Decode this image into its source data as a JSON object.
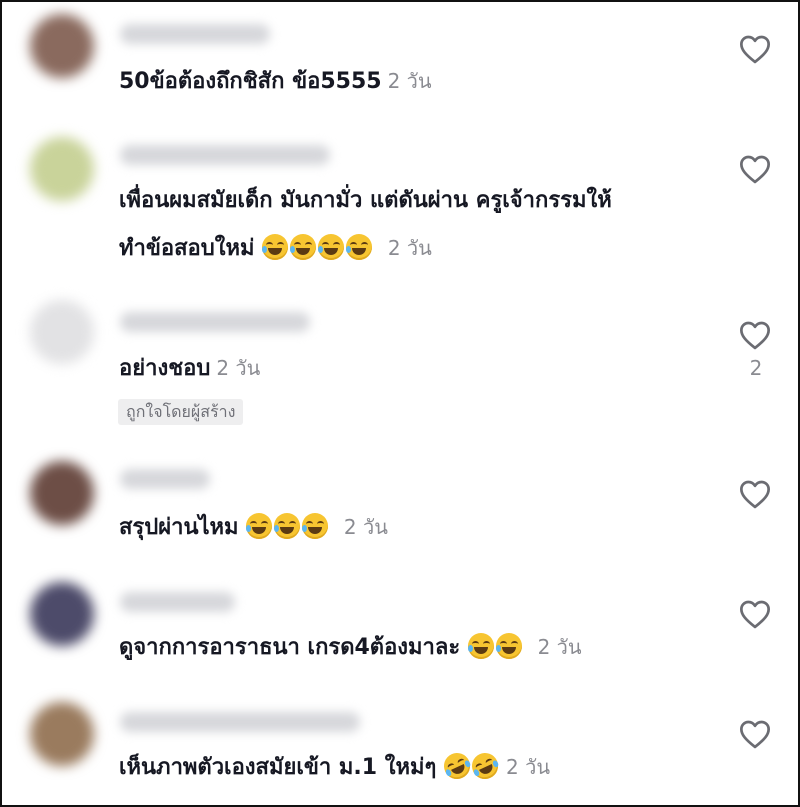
{
  "comments": [
    {
      "text": "50ข้อต้องถึกชิสัก ข้อ5555",
      "time": "2 วัน",
      "emoji_count": 0,
      "emoji": "",
      "avatar_color": "#8a6a5e"
    },
    {
      "text_line1": "เพื่อนผมสมัยเด็ก มันกามั่ว แต่ดันผ่าน ครูเจ้ากรรมให้",
      "text": "ทำข้อสอบใหม่",
      "time": "2 วัน",
      "emoji_count": 4,
      "emoji": "grinning-sweat-emoji",
      "avatar_color": "#c9d39a"
    },
    {
      "text": "อย่างชอบ",
      "time": "2 วัน",
      "likes": "2",
      "creator_badge": "ถูกใจโดยผู้สร้าง",
      "emoji_count": 0,
      "avatar_color": "#e2e2e4"
    },
    {
      "text": "สรุปผ่านไหม",
      "time": "2 วัน",
      "emoji_count": 3,
      "emoji": "grinning-sweat-emoji",
      "avatar_color": "#6d4e46"
    },
    {
      "text": "ดูจากการอาราธนา เกรด4ต้องมาละ",
      "time": "2 วัน",
      "emoji_count": 2,
      "emoji": "grinning-sweat-emoji",
      "avatar_color": "#4d4b6a"
    },
    {
      "text": "เห็นภาพตัวเองสมัยเข้า ม.1 ใหม่ๆ",
      "time": "2 วัน",
      "emoji_count": 2,
      "emoji": "rofl-emoji",
      "avatar_color": "#9a7b5e"
    }
  ],
  "icons": {
    "like": "heart-outline-icon"
  }
}
